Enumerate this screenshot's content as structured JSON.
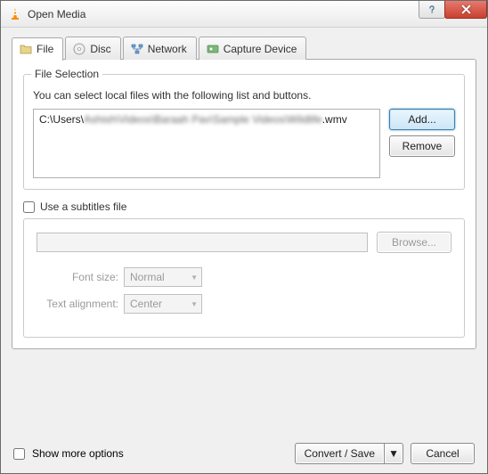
{
  "window": {
    "title": "Open Media"
  },
  "tabs": {
    "file": "File",
    "disc": "Disc",
    "network": "Network",
    "capture": "Capture Device"
  },
  "file_selection": {
    "group_title": "File Selection",
    "description": "You can select local files with the following list and buttons.",
    "entry_prefix": "C:\\Users\\",
    "entry_blurred": "Ashish\\Videos\\Baraah Pav\\Sample Videos\\Wildlife",
    "entry_suffix": ".wmv",
    "add_button": "Add...",
    "remove_button": "Remove"
  },
  "subtitles": {
    "checkbox_label": "Use a subtitles file",
    "browse_button": "Browse...",
    "font_size_label": "Font size:",
    "font_size_value": "Normal",
    "alignment_label": "Text alignment:",
    "alignment_value": "Center"
  },
  "options": {
    "show_more": "Show more options"
  },
  "footer": {
    "convert": "Convert / Save",
    "cancel": "Cancel"
  }
}
